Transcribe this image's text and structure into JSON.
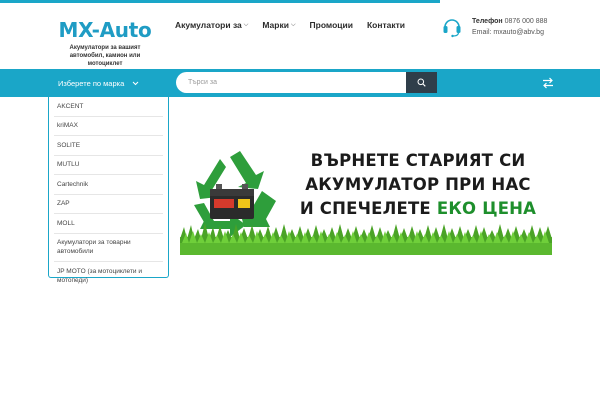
{
  "logo": {
    "part1": "MX",
    "part2": "-Auto",
    "tagline": "Акумулатори за вашият автомобил, камион или мотоциклет"
  },
  "nav": {
    "items": [
      {
        "label": "Акумулатори за",
        "dropdown": true
      },
      {
        "label": "Марки",
        "dropdown": true
      },
      {
        "label": "Промоции",
        "dropdown": false
      },
      {
        "label": "Контакти",
        "dropdown": false
      }
    ]
  },
  "contact": {
    "phone_label": "Телефон",
    "phone": "0876 000 888",
    "email_label": "Email:",
    "email": "mxauto@abv.bg",
    "icon": "headset-icon"
  },
  "toolbar": {
    "brand_select_label": "Изберете по марка",
    "search_placeholder": "Търси за",
    "search_icon": "search-icon",
    "compare_icon": "compare-arrows-icon"
  },
  "brands": [
    "AKCENT",
    "kriMAX",
    "SOLITE",
    "MUTLU",
    "Cartechnik",
    "ZAP",
    "MOLL",
    "Акумулатори за товарни автомобили",
    "JP MOTO (за мотоциклети и мотопеди)"
  ],
  "banner": {
    "line1": "ВЪРНЕТЕ СТАРИЯТ СИ",
    "line2": "АКУМУЛАТОР ПРИ НАС",
    "line3_prefix": "И СПЕЧЕЛЕТЕ",
    "line3_highlight": "ЕКО ЦЕНА"
  },
  "colors": {
    "accent": "#1aa6c8",
    "search_button": "#2f3e4a",
    "eco_green": "#1e8f2c"
  }
}
